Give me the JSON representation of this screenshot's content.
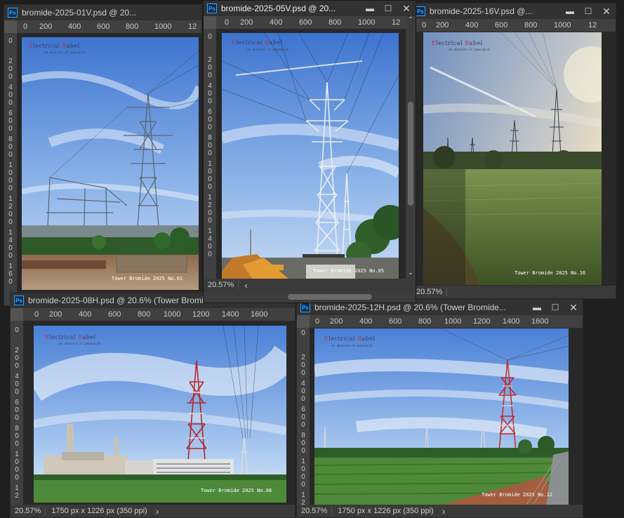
{
  "windows": [
    {
      "title": "bromide-2025-01V.psd @ 20...",
      "ruler": [
        "0",
        "200",
        "400",
        "600",
        "800",
        "1000",
        "12"
      ],
      "vruler": [
        "0",
        "2",
        "0",
        "0",
        "4",
        "0",
        "0",
        "6",
        "0",
        "0",
        "8",
        "0",
        "0",
        "1",
        "0",
        "0",
        "0",
        "1",
        "2",
        "0",
        "0",
        "1",
        "4",
        "0",
        "0",
        "1",
        "6",
        "0"
      ],
      "brand_a": "E",
      "brand_b": "lectrical ",
      "brand_c": "B",
      "brand_d": "abel",
      "subbrand": "-an observer of powergrid-",
      "caption": "Tower Bromide 2025 No.01"
    },
    {
      "title": "bromide-2025-05V.psd @ 20...",
      "ruler": [
        "0",
        "200",
        "400",
        "600",
        "800",
        "1000",
        "12"
      ],
      "vruler": [
        "0",
        "2",
        "0",
        "0",
        "4",
        "0",
        "0",
        "6",
        "0",
        "0",
        "8",
        "0",
        "0",
        "1",
        "0",
        "0",
        "0",
        "1",
        "2",
        "0",
        "0",
        "1",
        "4",
        "0",
        "0"
      ],
      "brand_a": "E",
      "brand_b": "lectrical ",
      "brand_c": "B",
      "brand_d": "abel",
      "subbrand": "-an observer of powergrid-",
      "caption": "Tower Bromide 2025 No.05",
      "zoom": "20.57%"
    },
    {
      "title": "bromide-2025-16V.psd @...",
      "ruler": [
        "0",
        "200",
        "400",
        "600",
        "800",
        "1000",
        "12"
      ],
      "brand_a": "E",
      "brand_b": "lectrical ",
      "brand_c": "B",
      "brand_d": "abel",
      "subbrand": "-an observer of powergrid-",
      "caption": "Tower Bromide 2025 No.16",
      "zoom": "20.57%"
    },
    {
      "title": "bromide-2025-08H.psd @ 20.6% (Tower Bromid...",
      "ruler": [
        "0",
        "200",
        "400",
        "600",
        "800",
        "1000",
        "1200",
        "1400",
        "1600"
      ],
      "vruler": [
        "0",
        "2",
        "0",
        "0",
        "4",
        "0",
        "0",
        "6",
        "0",
        "0",
        "8",
        "0",
        "0",
        "1",
        "0",
        "0",
        "0",
        "1",
        "2"
      ],
      "brand_a": "E",
      "brand_b": "lectrical ",
      "brand_c": "B",
      "brand_d": "abel",
      "subbrand": "-an observer of powergrid-",
      "caption": "Tower Bromide 2025 No.08",
      "zoom": "20.57%",
      "dims": "1750 px x 1226 px (350 ppi)"
    },
    {
      "title": "bromide-2025-12H.psd @ 20.6% (Tower Bromide...",
      "ruler": [
        "0",
        "200",
        "400",
        "600",
        "800",
        "1000",
        "1200",
        "1400",
        "1600"
      ],
      "vruler": [
        "0",
        "2",
        "0",
        "0",
        "4",
        "0",
        "0",
        "6",
        "0",
        "0",
        "8",
        "0",
        "0",
        "1",
        "0",
        "0",
        "0",
        "1",
        "2"
      ],
      "brand_a": "E",
      "brand_b": "lectrical ",
      "brand_c": "B",
      "brand_d": "abel",
      "subbrand": "-an observer of powergrid-",
      "caption": "Tower Bromide 2025 No.12",
      "zoom": "20.57%",
      "dims": "1750 px x 1226 px (350 ppi)"
    }
  ],
  "icons": {
    "ps": "Ps",
    "minimize": "▬",
    "maximize": "☐",
    "close": "✕",
    "scroll_left": "‹",
    "scroll_up": "⌃",
    "scroll_down": "⌄",
    "status_arrow": "›"
  },
  "colors": {
    "chrome": "#535353",
    "titlebar": "#323232",
    "ps_blue": "#31a8ff",
    "brand_red": "#c0303a"
  }
}
